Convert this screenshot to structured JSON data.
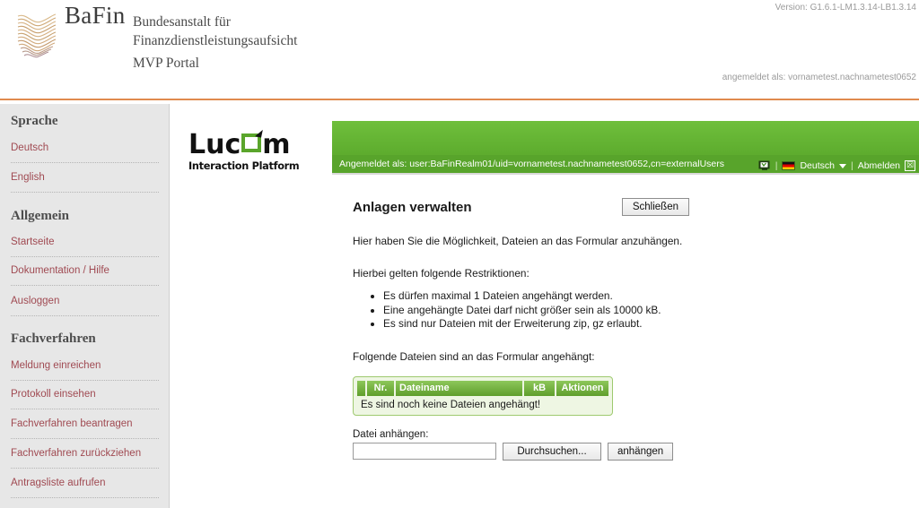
{
  "header": {
    "brand_name": "BaFin",
    "subtitle_line1": "Bundesanstalt für",
    "subtitle_line2": "Finanzdienstleistungsaufsicht",
    "portal_name": "MVP Portal",
    "version": "Version: G1.6.1-LM1.3.14-LB1.3.14",
    "logged_in_as": "angemeldet als: vornametest.nachnametest0652",
    "accent_color": "#e08a4e"
  },
  "sidebar": {
    "groups": [
      {
        "title": "Sprache",
        "items": [
          {
            "label": "Deutsch"
          },
          {
            "label": "English"
          }
        ]
      },
      {
        "title": "Allgemein",
        "items": [
          {
            "label": "Startseite"
          },
          {
            "label": "Dokumentation / Hilfe"
          },
          {
            "label": "Ausloggen"
          }
        ]
      },
      {
        "title": "Fachverfahren",
        "items": [
          {
            "label": "Meldung einreichen"
          },
          {
            "label": "Protokoll einsehen"
          },
          {
            "label": "Fachverfahren beantragen"
          },
          {
            "label": "Fachverfahren zurückziehen"
          },
          {
            "label": "Antragsliste aufrufen"
          }
        ]
      }
    ],
    "link_color": "#a04a52",
    "background_color": "#e7e7e7"
  },
  "app_logo": {
    "word_left": "Luc",
    "word_right": "m",
    "tagline": "Interaction Platform",
    "accent_color": "#5aa52b"
  },
  "green_bar": {
    "user_text": "Angemeldet als: user:BaFinRealm01/uid=vornametest.nachnametest0652,cn=externalUsers",
    "monitor_icon": "monitor-icon",
    "flag_icon": "german-flag-icon",
    "language_label": "Deutsch",
    "caret_icon": "chevron-down-icon",
    "logout_label": "Abmelden",
    "close_icon": "☒",
    "separator": "|",
    "color": "#5fae2f"
  },
  "panel": {
    "title": "Anlagen verwalten",
    "close_label": "Schließen",
    "intro": "Hier haben Sie die Möglichkeit, Dateien an das Formular anzuhängen.",
    "restrictions_intro": "Hierbei gelten folgende Restriktionen:",
    "restrictions": [
      "Es dürfen maximal 1 Dateien angehängt werden.",
      "Eine angehängte Datei darf nicht größer sein als 10000 kB.",
      "Es sind nur Dateien mit der Erweiterung zip, gz erlaubt."
    ],
    "attached_intro": "Folgende Dateien sind an das Formular angehängt:",
    "table": {
      "columns": [
        "Nr.",
        "Dateiname",
        "kB",
        "Aktionen"
      ],
      "empty_message": "Es sind noch keine Dateien angehängt!",
      "rows": []
    },
    "upload": {
      "label": "Datei anhängen:",
      "file_value": "",
      "file_placeholder": "",
      "browse_label": "Durchsuchen...",
      "attach_label": "anhängen"
    }
  }
}
